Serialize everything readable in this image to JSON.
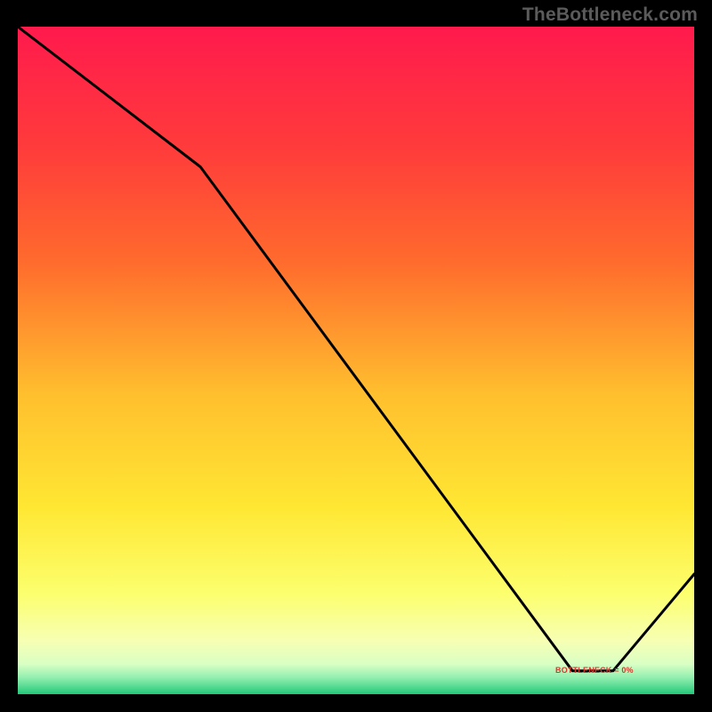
{
  "watermark": "TheBottleneck.com",
  "bottleneck_label": "BOTTLENECK = 0%",
  "chart_data": {
    "type": "line",
    "title": "",
    "xlabel": "",
    "ylabel": "",
    "x_range": [
      0,
      100
    ],
    "y_range_percent_from_top": [
      0,
      100
    ],
    "gradient_stops": [
      {
        "pos": 0.0,
        "color": "#ff1a4d"
      },
      {
        "pos": 0.18,
        "color": "#ff3b3b"
      },
      {
        "pos": 0.35,
        "color": "#ff6a2d"
      },
      {
        "pos": 0.55,
        "color": "#ffbf2e"
      },
      {
        "pos": 0.72,
        "color": "#ffe733"
      },
      {
        "pos": 0.85,
        "color": "#fcff6e"
      },
      {
        "pos": 0.92,
        "color": "#f7ffb3"
      },
      {
        "pos": 0.955,
        "color": "#d9ffc4"
      },
      {
        "pos": 0.975,
        "color": "#94efb0"
      },
      {
        "pos": 1.0,
        "color": "#22c879"
      }
    ],
    "line_points": [
      {
        "x": 0.0,
        "y": 0.0
      },
      {
        "x": 27.0,
        "y": 21.0
      },
      {
        "x": 82.0,
        "y": 96.5
      },
      {
        "x": 88.0,
        "y": 96.5
      },
      {
        "x": 100.0,
        "y": 82.0
      }
    ],
    "bottleneck_marker": {
      "x_start": 82.0,
      "x_end": 88.0,
      "y": 96.5
    }
  }
}
